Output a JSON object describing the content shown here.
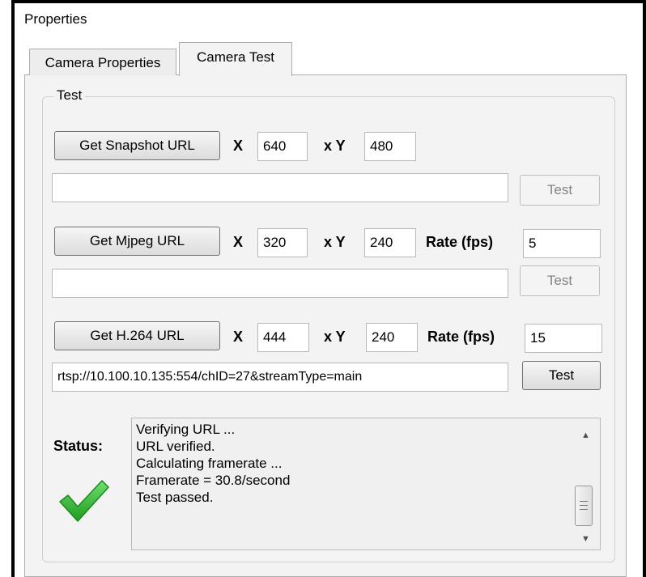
{
  "window": {
    "title": "Properties"
  },
  "tabs": [
    {
      "label": "Camera Properties",
      "active": false
    },
    {
      "label": "Camera Test",
      "active": true
    }
  ],
  "group": {
    "label": "Test"
  },
  "snapshot": {
    "button_label": "Get Snapshot URL",
    "x_label": "X",
    "x_value": "640",
    "y_label": "x Y",
    "y_value": "480",
    "url_value": "",
    "test_label": "Test",
    "test_enabled": false
  },
  "mjpeg": {
    "button_label": "Get Mjpeg URL",
    "x_label": "X",
    "x_value": "320",
    "y_label": "x Y",
    "y_value": "240",
    "rate_label": "Rate (fps)",
    "rate_value": "5",
    "url_value": "",
    "test_label": "Test",
    "test_enabled": false
  },
  "h264": {
    "button_label": "Get H.264 URL",
    "x_label": "X",
    "x_value": "444",
    "y_label": "x Y",
    "y_value": "240",
    "rate_label": "Rate (fps)",
    "rate_value": "15",
    "url_value": "rtsp://10.100.10.135:554/chID=27&streamType=main",
    "test_label": "Test",
    "test_enabled": true
  },
  "status": {
    "label": "Status:",
    "icon": "checkmark-icon",
    "icon_color": "#3cb43c",
    "lines": [
      "Verifying URL ...",
      "URL verified.",
      "Calculating framerate ...",
      "Framerate = 30.8/second",
      "Test passed."
    ]
  }
}
